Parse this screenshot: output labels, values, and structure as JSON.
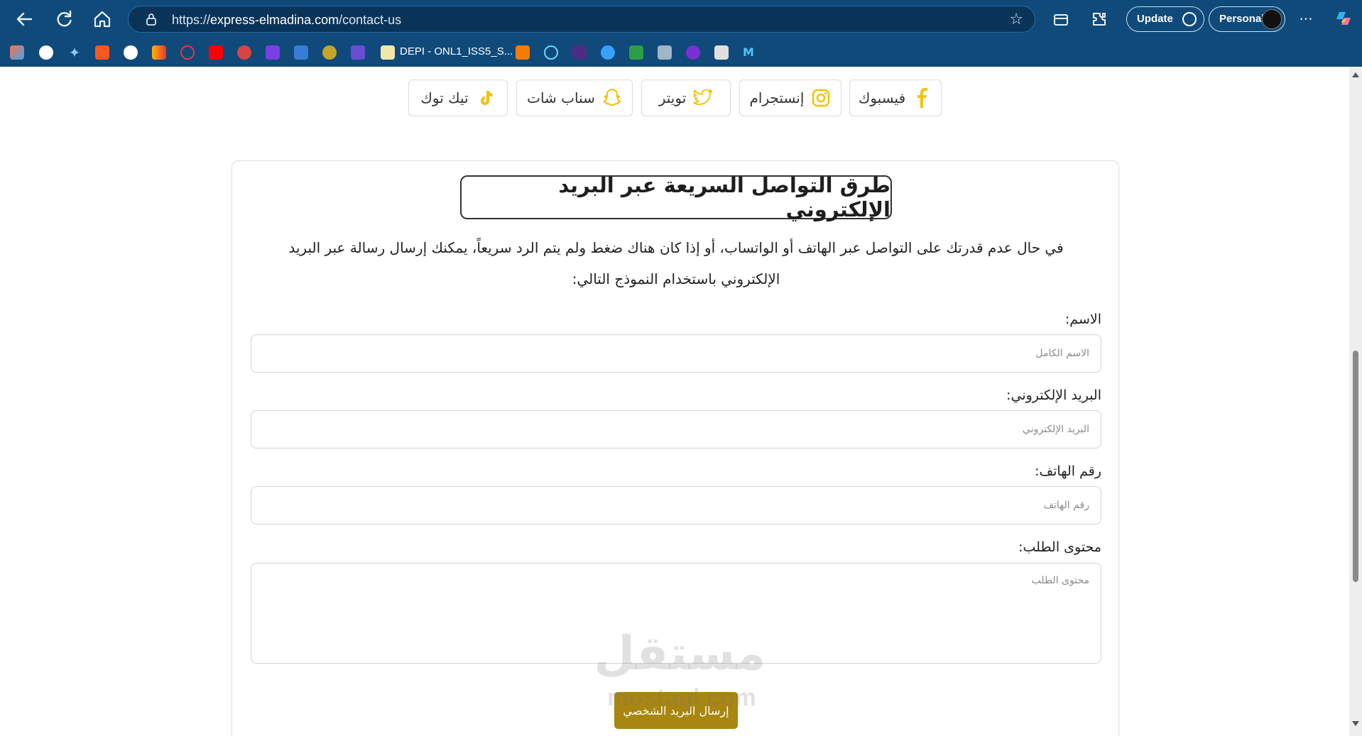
{
  "browser": {
    "url_scheme": "https://",
    "url_host": "express-elmadina.com",
    "url_path": "/contact-us",
    "update_label": "Update",
    "profile_label": "Personal",
    "bookmark_text": "DEPI - ONL1_ISS5_S..."
  },
  "social": {
    "facebook": "فيسبوك",
    "instagram": "إنستجرام",
    "twitter": "تويتر",
    "snapchat": "سناب شات",
    "tiktok": "تيك توك"
  },
  "form": {
    "title": "طرق التواصل السريعة عبر البريد الإلكتروني",
    "intro": "في حال عدم قدرتك على التواصل عبر الهاتف أو الواتساب، أو إذا كان هناك ضغط ولم يتم الرد سريعاً، يمكنك إرسال رسالة عبر البريد الإلكتروني باستخدام النموذج التالي:",
    "name_label": "الاسم:",
    "name_placeholder": "الاسم الكامل",
    "email_label": "البريد الإلكتروني:",
    "email_placeholder": "البريد الإلكتروني",
    "phone_label": "رقم الهاتف:",
    "phone_placeholder": "رقم الهاتف",
    "content_label": "محتوى الطلب:",
    "content_placeholder": "محتوى الطلب",
    "submit_label": "إرسال البريد الشخصي"
  },
  "watermark": {
    "arabic": "مستقل",
    "latin": "mostaql.com"
  },
  "colors": {
    "chrome": "#0f4a7a",
    "accent_gold": "#f2c200",
    "submit": "#a8860f"
  }
}
